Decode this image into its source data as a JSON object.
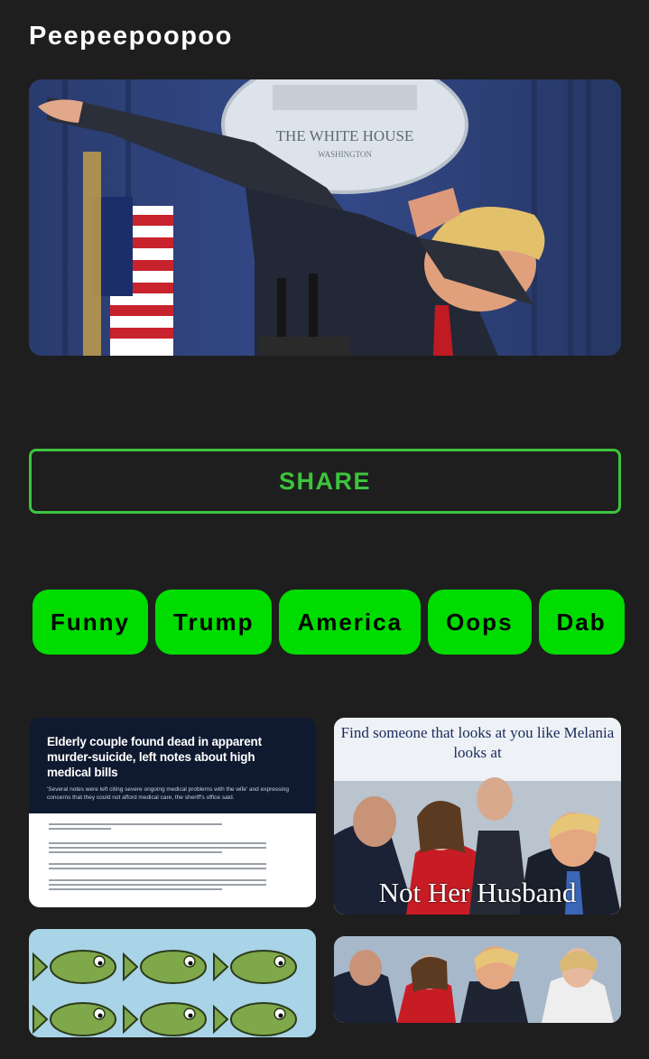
{
  "page": {
    "title": "Peepeepoopoo"
  },
  "hero": {
    "seal_text": "THE WHITE HOUSE",
    "seal_subtext": "WASHINGTON"
  },
  "share": {
    "label": "SHARE"
  },
  "tags": [
    {
      "label": "Funny"
    },
    {
      "label": "Trump"
    },
    {
      "label": "America"
    },
    {
      "label": "Oops"
    },
    {
      "label": "Dab"
    }
  ],
  "related": {
    "news_card": {
      "headline": "Elderly couple found dead in apparent murder-suicide, left notes about high medical bills",
      "subheadline": "'Several notes were left citing severe ongoing medical problems with the wife' and expressing concerns that they could not afford medical care, the sheriff's office said."
    },
    "melania_card": {
      "top_caption": "Find someone that looks at you like Melania looks at",
      "bottom_caption": "Not Her Husband"
    }
  },
  "colors": {
    "background": "#1e1e1e",
    "accent_green": "#3dc43d",
    "tag_green": "#00db00"
  }
}
